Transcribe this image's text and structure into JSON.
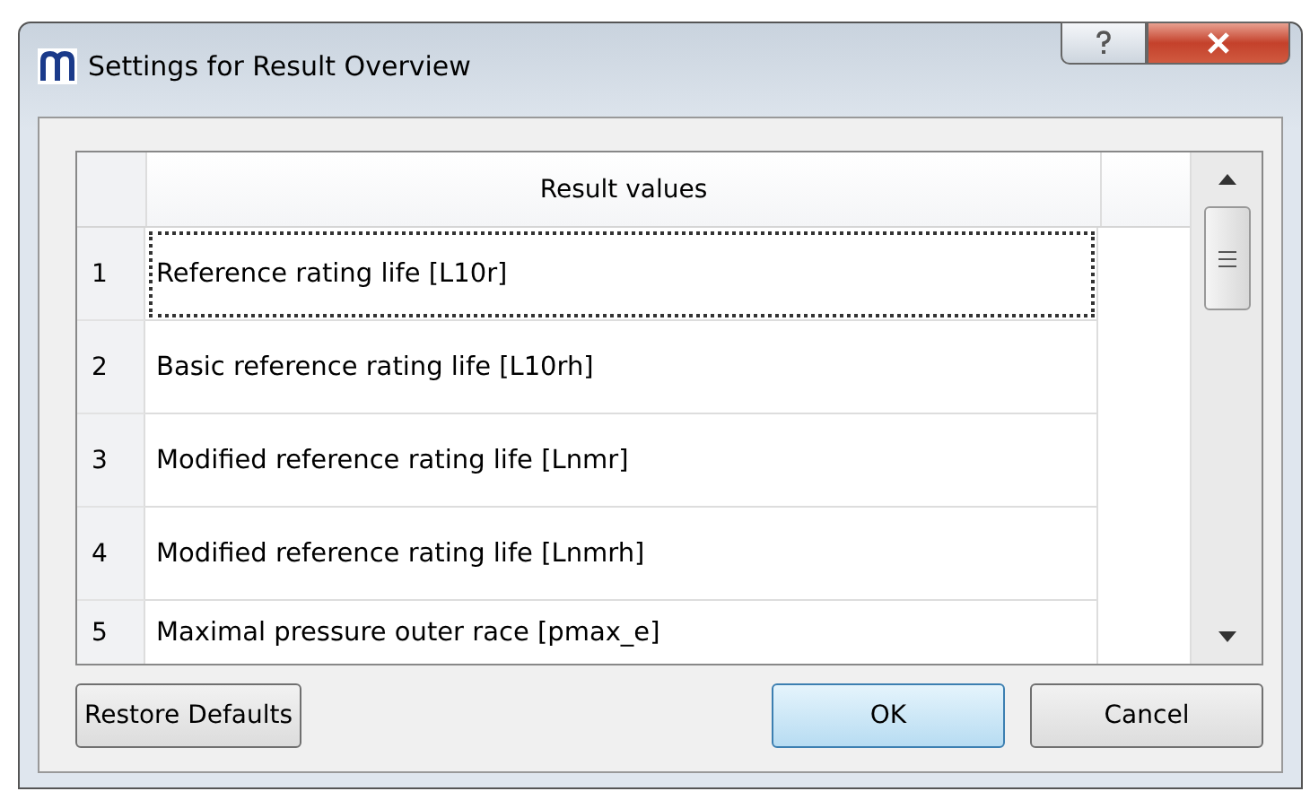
{
  "window": {
    "title": "Settings for Result Overview"
  },
  "table": {
    "columns": [
      "Result values"
    ],
    "rows": [
      {
        "number": "1",
        "value": "Reference rating life [L10r]",
        "selected": true
      },
      {
        "number": "2",
        "value": "Basic reference rating life [L10rh]",
        "selected": false
      },
      {
        "number": "3",
        "value": "Modified reference rating life [Lnmr]",
        "selected": false
      },
      {
        "number": "4",
        "value": "Modified reference rating life [Lnmrh]",
        "selected": false
      },
      {
        "number": "5",
        "value": "Maximal pressure outer race [pmax_e]",
        "selected": false
      }
    ]
  },
  "buttons": [
    {
      "label": "Restore Defaults",
      "default": false,
      "kind": "left"
    },
    {
      "label": "OK",
      "default": true,
      "kind": "right"
    },
    {
      "label": "Cancel",
      "default": false,
      "kind": "right"
    }
  ]
}
